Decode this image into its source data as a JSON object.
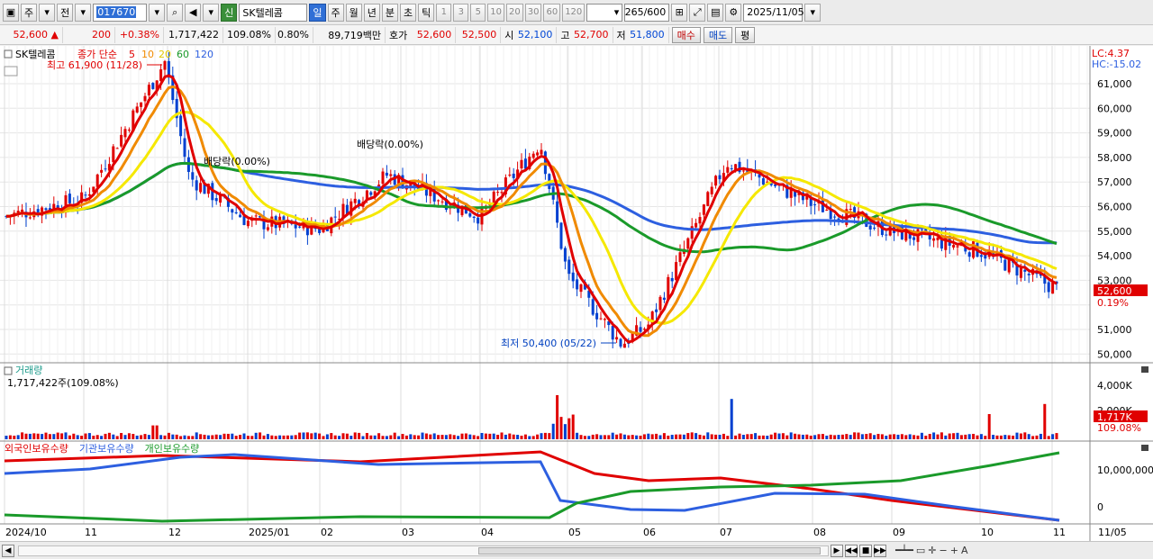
{
  "toolbar": {
    "week_btn": "주",
    "prev_btn": "전",
    "code_value": "017670",
    "stock_name": "SK텔레콤",
    "sin_badge": "신",
    "periods": [
      "일",
      "주",
      "월",
      "년",
      "분",
      "초",
      "틱"
    ],
    "minute_values": [
      "1",
      "3",
      "5",
      "10",
      "20",
      "30",
      "60",
      "120"
    ],
    "count": "265",
    "count_max": "/600",
    "date": "2025/11/05"
  },
  "quote": {
    "price": "52,600",
    "arrow": "▲",
    "change": "200",
    "change_rate": "+0.38%",
    "volume": "1,717,422",
    "volume_rate": "109.08%",
    "turnover_rate": "0.80%",
    "amount": "89,719백만",
    "hoga_label": "호가",
    "ask": "52,600",
    "bid": "52,500",
    "open_label": "시",
    "open": "52,100",
    "high_label": "고",
    "high": "52,700",
    "low_label": "저",
    "low": "51,800",
    "buy_btn": "매수",
    "sell_btn": "매도",
    "avg_btn": "평"
  },
  "price_panel": {
    "name": "SK텔레콤",
    "ma_label": "종가 단순",
    "ma_periods": [
      "5",
      "10",
      "20",
      "60",
      "120"
    ],
    "ma_colors": {
      "5": "#e00000",
      "10": "#f08a00",
      "20": "#f0e000",
      "60": "#1a9a2a",
      "120": "#2d5fe0"
    },
    "lc": "LC:4.37",
    "hc": "HC:-15.02",
    "high_marker": "최고 61,900 (11/28)",
    "low_marker": "최저 50,400 (05/22)",
    "dividend1": "배당락(0.00%)",
    "dividend2": "배당락(0.00%)",
    "yaxis": [
      "61,000",
      "60,000",
      "59,000",
      "58,000",
      "57,000",
      "56,000",
      "55,000",
      "54,000",
      "53,000",
      "52,000",
      "51,000",
      "50,000"
    ],
    "last_price": "52,600",
    "last_pct": "0.19%"
  },
  "volume_panel": {
    "title": "거래량",
    "value": "1,717,422주(109.08%)",
    "yaxis_top": "4,000K",
    "yaxis_mid": "2,000K",
    "last": "1,717K",
    "last_pct": "109.08%"
  },
  "holdings_panel": {
    "series": [
      "외국인보유수량",
      "기관보유수량",
      "개인보유수량"
    ],
    "colors": [
      "#e00000",
      "#2d5fe0",
      "#1a9a2a"
    ],
    "yaxis_top": "10,000,000",
    "yaxis_zero": "0"
  },
  "xaxis": [
    "2024/10",
    "11",
    "12",
    "2025/01",
    "02",
    "03",
    "04",
    "05",
    "06",
    "07",
    "08",
    "09",
    "10",
    "11",
    "11/05"
  ],
  "chart_data": {
    "type": "candlestick",
    "ylim": [
      50000,
      62000
    ],
    "points": [
      [
        "2024/10",
        55600
      ],
      [
        "11",
        56300
      ],
      [
        "11/28",
        61900
      ],
      [
        "12",
        57200
      ],
      [
        "2025/01",
        55400
      ],
      [
        "02",
        55100
      ],
      [
        "03",
        57300
      ],
      [
        "04",
        55600
      ],
      [
        "04/28",
        58600
      ],
      [
        "05",
        53200
      ],
      [
        "05/22",
        50400
      ],
      [
        "06",
        51200
      ],
      [
        "07",
        57200
      ],
      [
        "07/08",
        57800
      ],
      [
        "08",
        56100
      ],
      [
        "09",
        55000
      ],
      [
        "10",
        54200
      ],
      [
        "11",
        52600
      ]
    ],
    "last_close": 52600
  }
}
